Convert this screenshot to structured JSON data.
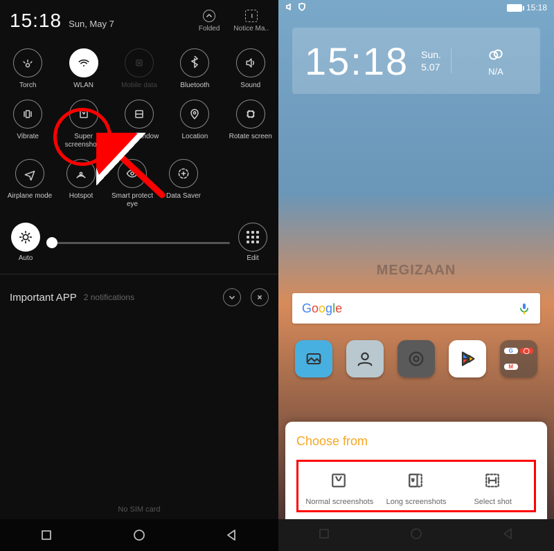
{
  "left": {
    "time": "15:18",
    "date": "Sun, May 7",
    "folded_label": "Folded",
    "notice_label": "Notice Ma..",
    "toggles_row1": [
      {
        "name": "torch",
        "label": "Torch",
        "state": "off"
      },
      {
        "name": "wlan",
        "label": "WLAN",
        "state": "on"
      },
      {
        "name": "mobiledata",
        "label": "Mobile data",
        "state": "dim"
      },
      {
        "name": "bluetooth",
        "label": "Bluetooth",
        "state": "off"
      },
      {
        "name": "sound",
        "label": "Sound",
        "state": "off"
      }
    ],
    "toggles_row2": [
      {
        "name": "vibrate",
        "label": "Vibrate",
        "state": "off"
      },
      {
        "name": "superscreenshots",
        "label": "Super screenshots",
        "state": "off"
      },
      {
        "name": "multiwindow",
        "label": "MultiWindow",
        "state": "off"
      },
      {
        "name": "location",
        "label": "Location",
        "state": "off"
      },
      {
        "name": "rotate",
        "label": "Rotate screen",
        "state": "off"
      }
    ],
    "toggles_row3": [
      {
        "name": "airplane",
        "label": "Airplane mode",
        "state": "off"
      },
      {
        "name": "hotspot",
        "label": "Hotspot",
        "state": "off"
      },
      {
        "name": "smarteye",
        "label": "Smart protect eye",
        "state": "off"
      },
      {
        "name": "datasaver",
        "label": "Data Saver",
        "state": "off"
      }
    ],
    "brightness": {
      "auto_label": "Auto",
      "edit_label": "Edit",
      "value_percent": 2
    },
    "notification": {
      "title": "Important APP",
      "subtitle": "2 notifications"
    },
    "no_sim": "No SIM card"
  },
  "right": {
    "status_time": "15:18",
    "clock": {
      "time": "15:18",
      "day": "Sun.",
      "date": "5.07",
      "weather": "N/A"
    },
    "google_label": "Google",
    "watermark": "MEGIZAAN",
    "apps": [
      "Gallery",
      "Contacts",
      "Settings",
      "Play Store",
      "Google"
    ],
    "sheet": {
      "title": "Choose from",
      "options": [
        {
          "name": "normal",
          "label": "Normal screenshots"
        },
        {
          "name": "long",
          "label": "Long screenshots"
        },
        {
          "name": "select",
          "label": "Select shot"
        }
      ]
    }
  },
  "annotations": {
    "highlighted_toggle": "superscreenshots",
    "highlighted_sheet_options": true
  }
}
